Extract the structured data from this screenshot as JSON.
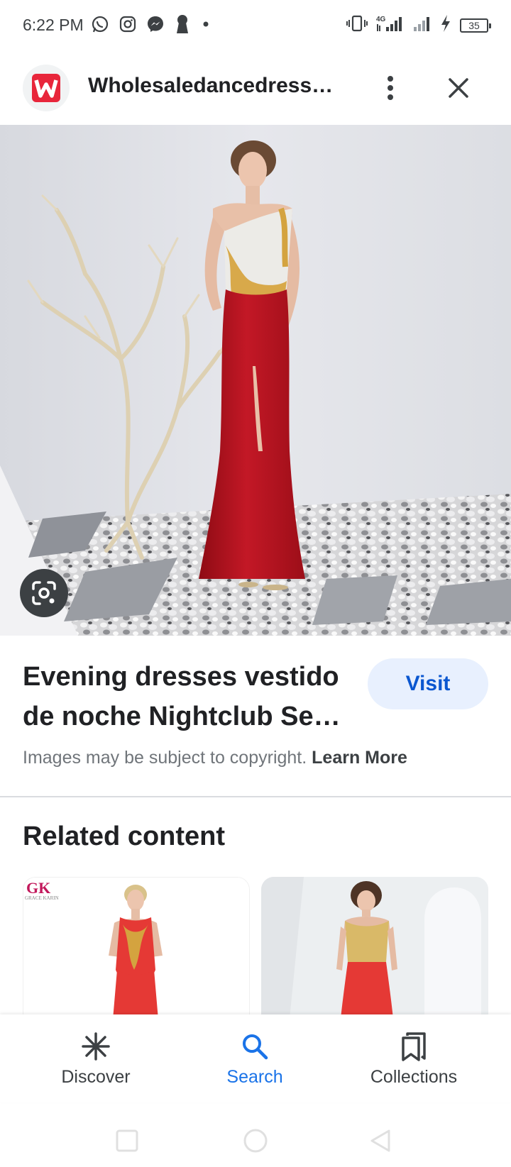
{
  "status_bar": {
    "time": "6:22 PM",
    "battery": "35",
    "network": "4G",
    "left_icons": [
      "whatsapp-icon",
      "instagram-icon",
      "messenger-icon",
      "keyhole-icon",
      "dot-icon"
    ],
    "right_icons": [
      "vibrate-icon",
      "signal-4g-icon",
      "signal-icon",
      "charging-icon",
      "battery-icon"
    ]
  },
  "header": {
    "site_name": "Wholesaledancedress.…",
    "logo_letter": "W",
    "logo_color": "#e8263b",
    "more_icon": "more-vert-icon",
    "close_icon": "close-icon"
  },
  "hero": {
    "lens_icon": "google-lens-icon"
  },
  "result": {
    "title": "Evening dresses vestido de noche Nightclub Se…",
    "visit_label": "Visit",
    "copyright_text": "Images may be subject to copyright.",
    "learn_more": "Learn More"
  },
  "related": {
    "heading": "Related content",
    "card1_brand": "GK",
    "card1_brand_sub": "GRACE KARIN"
  },
  "bottom_nav": {
    "items": [
      {
        "label": "Discover",
        "icon": "asterisk-icon"
      },
      {
        "label": "Search",
        "icon": "search-icon",
        "active": true
      },
      {
        "label": "Collections",
        "icon": "bookmarks-icon"
      }
    ]
  },
  "colors": {
    "accent": "#1a73e8",
    "visit_bg": "#e8f0fe",
    "visit_text": "#0b57d0",
    "dress_red": "#b81420"
  }
}
